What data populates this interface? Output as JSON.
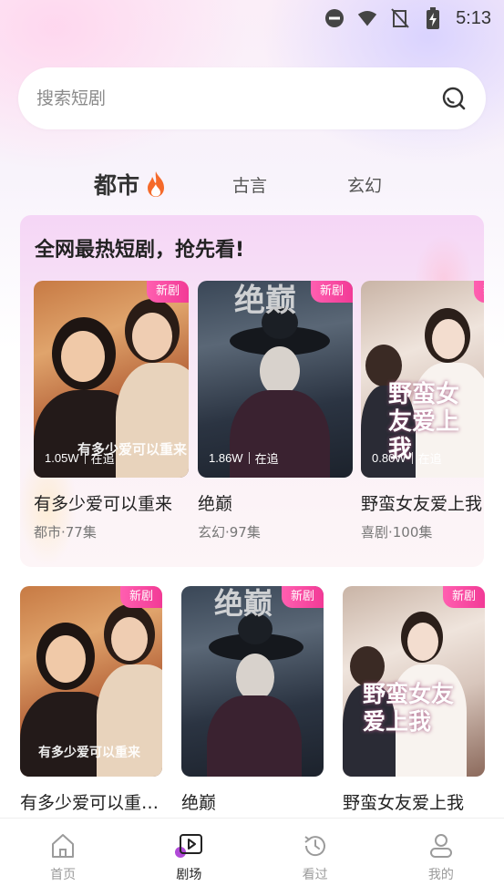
{
  "status_bar": {
    "time": "5:13"
  },
  "search": {
    "placeholder": "搜索短剧"
  },
  "tabs": [
    {
      "label": "都市",
      "active": true
    },
    {
      "label": "古言",
      "active": false
    },
    {
      "label": "玄幻",
      "active": false
    }
  ],
  "hot_section": {
    "title": "全网最热短剧，抢先看!",
    "items": [
      {
        "badge": "新剧",
        "views": "1.05W",
        "status": "在追",
        "title": "有多少爱可以重来",
        "meta": "都市·77集",
        "poster_text": "有多少爱可以重来"
      },
      {
        "badge": "新剧",
        "views": "1.86W",
        "status": "在追",
        "title": "绝巅",
        "meta": "玄幻·97集",
        "poster_text": "绝巅"
      },
      {
        "badge": "新剧",
        "views": "0.80W",
        "status": "在追",
        "title": "野蛮女友爱上我",
        "meta": "喜剧·100集",
        "poster_text": "野蛮女友爱上我"
      }
    ]
  },
  "grid": [
    {
      "badge": "新剧",
      "title": "有多少爱可以重…",
      "poster_text": "有多少爱可以重来"
    },
    {
      "badge": "新剧",
      "title": "绝巅",
      "poster_text": "绝巅"
    },
    {
      "badge": "新剧",
      "title": "野蛮女友爱上我",
      "poster_text": "野蛮女友爱上我"
    }
  ],
  "bottom_nav": [
    {
      "label": "首页",
      "icon": "home-icon",
      "active": false
    },
    {
      "label": "剧场",
      "icon": "theater-icon",
      "active": true
    },
    {
      "label": "看过",
      "icon": "history-icon",
      "active": false
    },
    {
      "label": "我的",
      "icon": "profile-icon",
      "active": false
    }
  ],
  "colors": {
    "badge": "#f23a96",
    "accent": "#a33fd0",
    "panel_bg": "#f5d6f6"
  }
}
